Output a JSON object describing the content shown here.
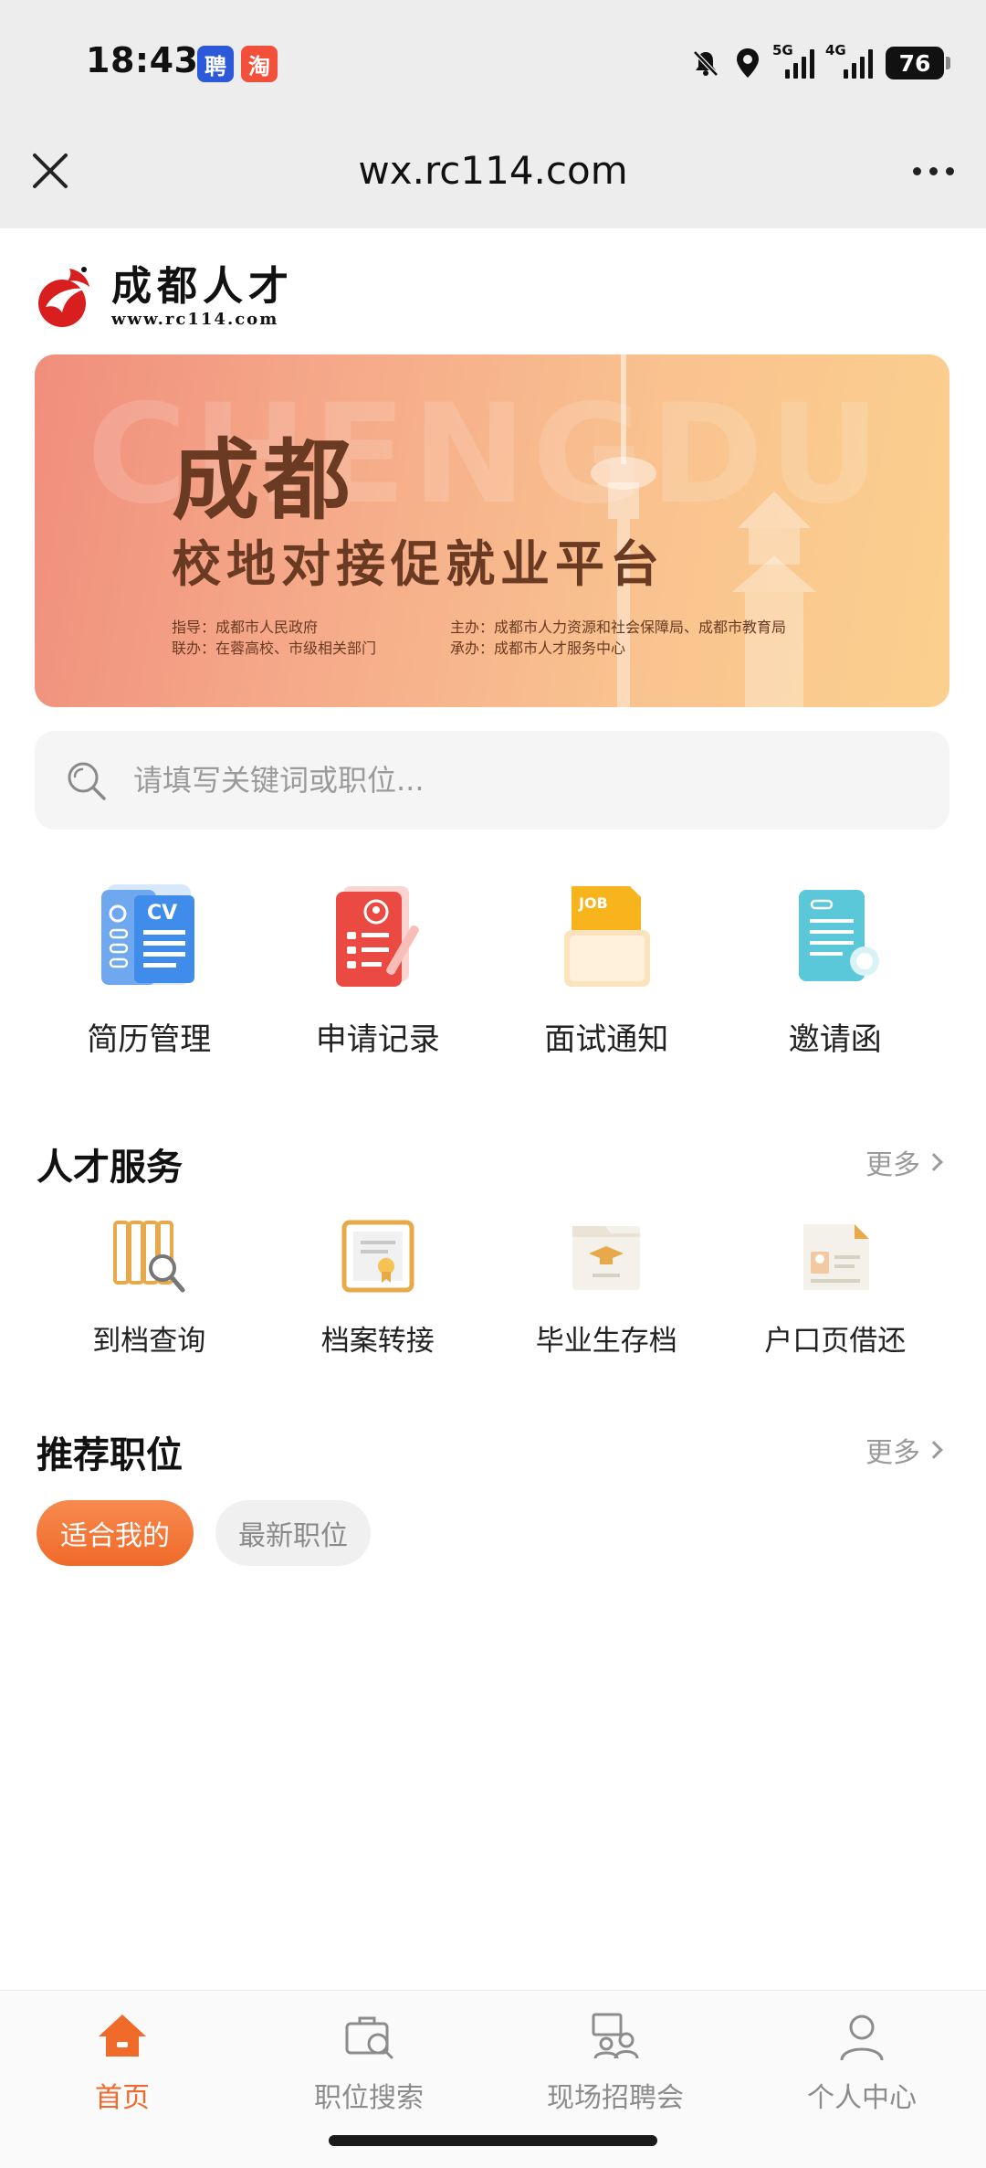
{
  "status_bar": {
    "time": "18:43",
    "app_icon_1": "聘",
    "app_icon_2": "淘",
    "network_1": "5G",
    "network_2": "4G",
    "battery": "76"
  },
  "browser": {
    "title": "wx.rc114.com",
    "close_icon": "close-icon",
    "more_icon": "more-dots-icon"
  },
  "logo": {
    "name": "成都人才",
    "url": "www.rc114.com"
  },
  "banner": {
    "bg_text": "CHENGDU",
    "title_main": "成都",
    "title_sub": "校地对接促就业平台",
    "guide": "指导：成都市人民政府",
    "joint": "联办：在蓉高校、市级相关部门",
    "host": "主办：成都市人力资源和社会保障局、成都市教育局",
    "organizer": "承办：成都市人才服务中心"
  },
  "search": {
    "placeholder": "请填写关键词或职位..."
  },
  "quick_entries": [
    {
      "label": "简历管理",
      "icon": "resume-cv-icon"
    },
    {
      "label": "申请记录",
      "icon": "application-record-icon"
    },
    {
      "label": "面试通知",
      "icon": "job-folder-icon"
    },
    {
      "label": "邀请函",
      "icon": "invitation-letter-icon"
    }
  ],
  "talent_services": {
    "title": "人才服务",
    "more": "更多",
    "items": [
      {
        "label": "到档查询",
        "icon": "archive-search-icon"
      },
      {
        "label": "档案转接",
        "icon": "certificate-transfer-icon"
      },
      {
        "label": "毕业生存档",
        "icon": "graduate-archive-icon"
      },
      {
        "label": "户口页借还",
        "icon": "household-page-icon"
      }
    ]
  },
  "recommended_jobs": {
    "title": "推荐职位",
    "more": "更多",
    "tags": [
      {
        "label": "适合我的",
        "active": true
      },
      {
        "label": "最新职位",
        "active": false
      }
    ]
  },
  "tabbar": [
    {
      "label": "首页",
      "icon": "home-icon",
      "active": true
    },
    {
      "label": "职位搜索",
      "icon": "briefcase-search-icon",
      "active": false
    },
    {
      "label": "现场招聘会",
      "icon": "job-fair-icon",
      "active": false
    },
    {
      "label": "个人中心",
      "icon": "person-icon",
      "active": false
    }
  ],
  "colors": {
    "accent": "#ef6a2c",
    "banner_text": "#6a3a22",
    "status_bg": "#ededed"
  }
}
